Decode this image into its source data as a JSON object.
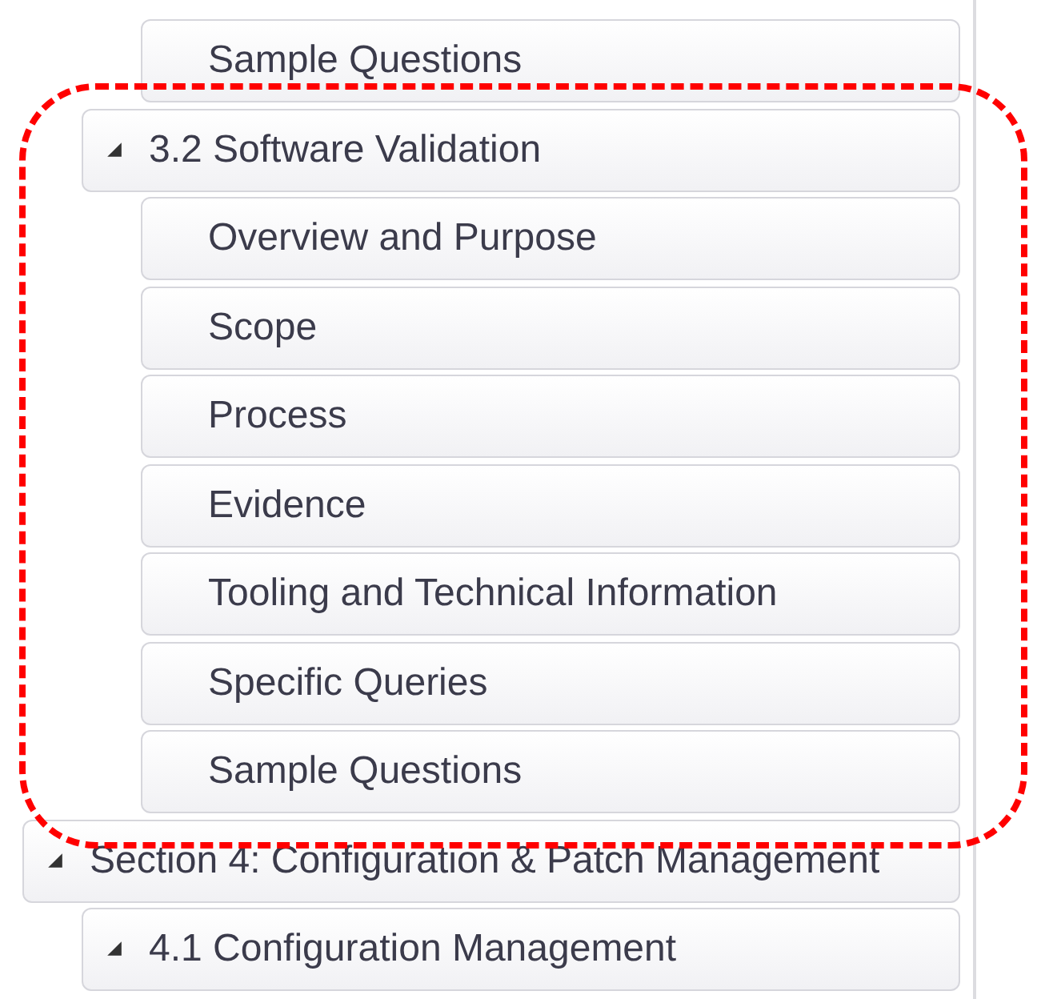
{
  "tree": [
    {
      "children": [
        {
          "children": [
            {
              "label": "Sample Questions"
            }
          ]
        },
        {
          "label": "3.2 Software Validation",
          "expanded": true,
          "children": [
            {
              "label": "Overview and Purpose"
            },
            {
              "label": "Scope"
            },
            {
              "label": "Process"
            },
            {
              "label": "Evidence"
            },
            {
              "label": "Tooling and Technical Information"
            },
            {
              "label": "Specific Queries"
            },
            {
              "label": "Sample Questions"
            }
          ]
        }
      ]
    },
    {
      "label": "Section 4: Configuration & Patch Management",
      "expanded": true,
      "children": [
        {
          "label": "4.1 Configuration Management",
          "expanded": true
        }
      ]
    }
  ],
  "annotation": {
    "kind": "dashed-outline"
  }
}
